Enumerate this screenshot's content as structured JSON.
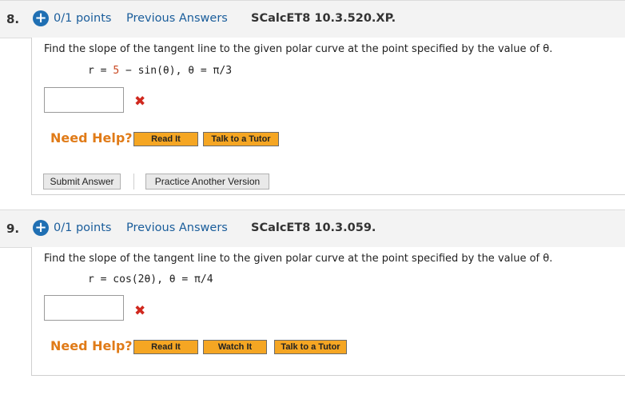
{
  "questions": [
    {
      "number": "8.",
      "expand_icon": "plus-circle-icon",
      "points": "0/1 points",
      "previous_answers": "Previous Answers",
      "code": "SCalcET8 10.3.520.XP.",
      "prompt": "Find the slope of the tangent line to the given polar curve at the point specified by the value of θ.",
      "formula_prefix": "r = ",
      "formula_num": "5",
      "formula_rest": " − sin(θ),    θ = π/3",
      "answer_value": "",
      "status_icon": "incorrect-x-icon",
      "need_help": "Need Help?",
      "help_buttons": [
        "Read It",
        "Talk to a Tutor"
      ],
      "submit_label": "Submit Answer",
      "practice_label": "Practice Another Version"
    },
    {
      "number": "9.",
      "expand_icon": "plus-circle-icon",
      "points": "0/1 points",
      "previous_answers": "Previous Answers",
      "code": "SCalcET8 10.3.059.",
      "prompt": "Find the slope of the tangent line to the given polar curve at the point specified by the value of θ.",
      "formula": "r = cos(2θ),    θ = π/4",
      "answer_value": "",
      "status_icon": "incorrect-x-icon",
      "need_help": "Need Help?",
      "help_buttons": [
        "Read It",
        "Watch It",
        "Talk to a Tutor"
      ]
    }
  ],
  "colors": {
    "link_blue": "#1a5d9b",
    "help_orange": "#e07b18",
    "button_orange": "#f5a623",
    "error_red": "#d0281e"
  }
}
